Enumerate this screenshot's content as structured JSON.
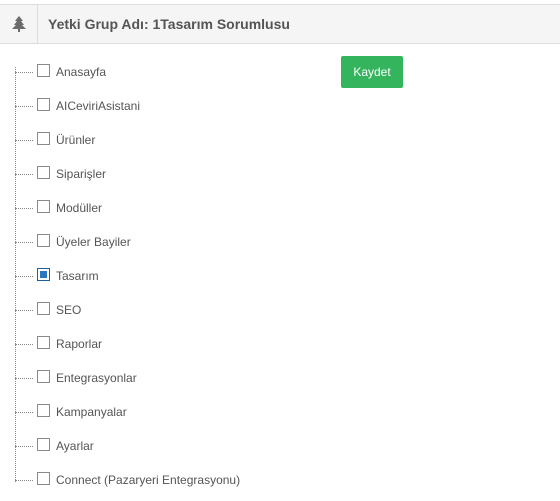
{
  "header": {
    "icon": "tree-icon",
    "title": "Yetki Grup Adı: 1Tasarım Sorumlusu"
  },
  "actions": {
    "save_label": "Kaydet",
    "save_color": "#35b45e"
  },
  "tree": {
    "items": [
      {
        "label": "Anasayfa",
        "checked": false
      },
      {
        "label": "AICeviriAsistani",
        "checked": false
      },
      {
        "label": "Ürünler",
        "checked": false
      },
      {
        "label": "Siparişler",
        "checked": false
      },
      {
        "label": "Modüller",
        "checked": false
      },
      {
        "label": "Üyeler Bayiler",
        "checked": false
      },
      {
        "label": "Tasarım",
        "checked": true
      },
      {
        "label": "SEO",
        "checked": false
      },
      {
        "label": "Raporlar",
        "checked": false
      },
      {
        "label": "Entegrasyonlar",
        "checked": false
      },
      {
        "label": "Kampanyalar",
        "checked": false
      },
      {
        "label": "Ayarlar",
        "checked": false
      },
      {
        "label": "Connect (Pazaryeri Entegrasyonu)",
        "checked": false
      }
    ]
  }
}
